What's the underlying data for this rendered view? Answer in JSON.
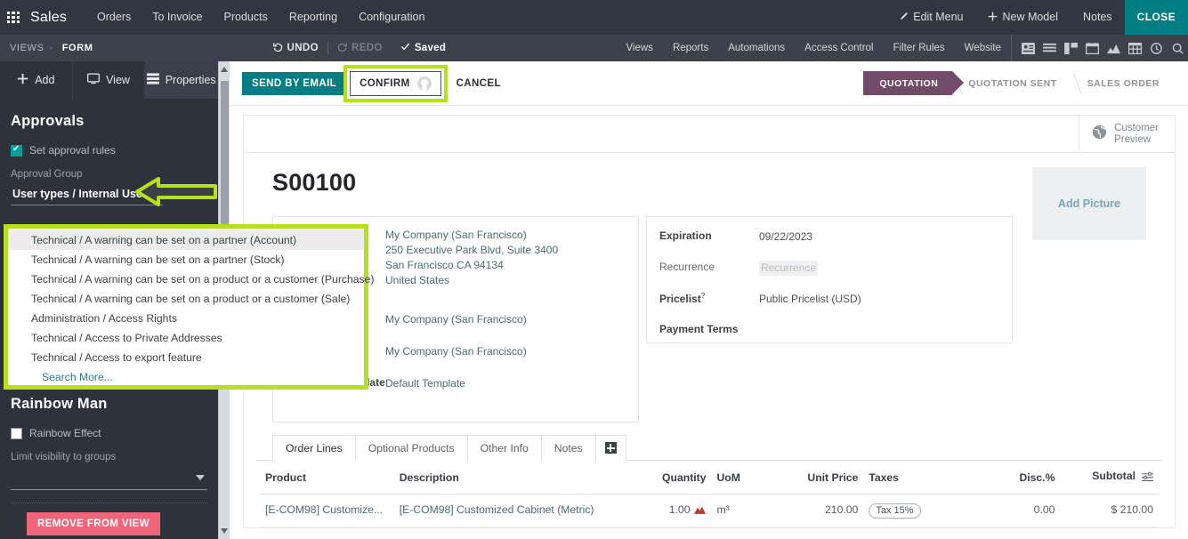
{
  "navbar": {
    "apps_icon": "apps-grid-icon",
    "brand": "Sales",
    "menu": [
      "Orders",
      "To Invoice",
      "Products",
      "Reporting",
      "Configuration"
    ],
    "right": [
      {
        "label": "Edit Menu",
        "icon": "pencil-icon"
      },
      {
        "label": "New Model",
        "icon": "plus-icon"
      },
      {
        "label": "Notes",
        "icon": ""
      }
    ],
    "close_label": "CLOSE"
  },
  "subbar": {
    "views_label": "VIEWS",
    "separator": "·",
    "form_label": "FORM",
    "undo_label": "UNDO",
    "redo_label": "REDO",
    "saved_label": "Saved",
    "links": [
      "Views",
      "Reports",
      "Automations",
      "Access Control",
      "Filter Rules",
      "Website"
    ],
    "icons": [
      "kanban-icon",
      "list-icon",
      "gantt-icon",
      "calendar-icon",
      "graph-icon",
      "pivot-icon",
      "activity-icon",
      "search-icon"
    ]
  },
  "sidebar": {
    "tabs": [
      {
        "label": "Add",
        "icon": "plus-icon",
        "active": false
      },
      {
        "label": "View",
        "icon": "monitor-icon",
        "active": false
      },
      {
        "label": "Properties",
        "icon": "properties-icon",
        "active": true
      }
    ],
    "approvals": {
      "title": "Approvals",
      "checkbox_label": "Set approval rules",
      "checkbox_checked": true,
      "group_label": "Approval Group",
      "group_value": "User types / Internal User",
      "filter_icon": "funnel-icon",
      "delete_icon": "trash-icon"
    },
    "rainbow": {
      "title": "Rainbow Man",
      "checkbox_label": "Rainbow Effect",
      "checkbox_checked": false,
      "limit_label": "Limit visibility to groups",
      "limit_value": "",
      "remove_label": "REMOVE FROM VIEW"
    }
  },
  "dropdown": {
    "items": [
      {
        "label": "Technical / A warning can be set on a partner (Account)",
        "highlighted": true
      },
      {
        "label": "Technical / A warning can be set on a partner (Stock)",
        "highlighted": false
      },
      {
        "label": "Technical / A warning can be set on a product or a customer (Purchase)",
        "highlighted": false
      },
      {
        "label": "Technical / A warning can be set on a product or a customer (Sale)",
        "highlighted": false
      },
      {
        "label": "Administration / Access Rights",
        "highlighted": false
      },
      {
        "label": "Technical / Access to Private Addresses",
        "highlighted": false
      },
      {
        "label": "Technical / Access to export feature",
        "highlighted": false
      }
    ],
    "search_more": "Search More...",
    "highlight_color": "#b4e01c"
  },
  "statusbar": {
    "send_by_email": "SEND BY EMAIL",
    "confirm": "CONFIRM",
    "confirm_badge_icon": "avatar-badge-icon",
    "cancel": "CANCEL",
    "pipeline": [
      {
        "label": "QUOTATION",
        "active": true
      },
      {
        "label": "QUOTATION SENT",
        "active": false
      },
      {
        "label": "SALES ORDER",
        "active": false
      }
    ],
    "active_color": "#714b67"
  },
  "sheet": {
    "customer_preview": {
      "line1": "Customer",
      "line2": "Preview",
      "icon": "globe-icon"
    },
    "doc_title": "S00100",
    "add_picture": "Add Picture",
    "left": {
      "customer_name": "My Company (San Francisco)",
      "address_line1": "250 Executive Park Blvd, Suite 3400",
      "address_line2": "San Francisco CA 94134",
      "address_line3": "United States",
      "invoice_address": "My Company (San Francisco)",
      "delivery_address": "My Company (San Francisco)",
      "quotation_template_label": "Quotation Template",
      "quotation_template_value": "Default Template"
    },
    "right": [
      {
        "label": "Expiration",
        "value": "09/22/2023",
        "bold": true,
        "muted": false
      },
      {
        "label": "Recurrence",
        "value": "Recurrence",
        "bold": false,
        "muted": true
      },
      {
        "label": "Pricelist",
        "value": "Public Pricelist (USD)",
        "bold": true,
        "muted": false,
        "help": "?"
      },
      {
        "label": "Payment Terms",
        "value": "",
        "bold": true,
        "muted": false
      }
    ]
  },
  "tabs": [
    {
      "label": "Order Lines",
      "active": true
    },
    {
      "label": "Optional Products",
      "active": false
    },
    {
      "label": "Other Info",
      "active": false
    },
    {
      "label": "Notes",
      "active": false
    }
  ],
  "table": {
    "columns": [
      "Product",
      "Description",
      "Quantity",
      "UoM",
      "Unit Price",
      "Taxes",
      "Disc.%",
      "Subtotal"
    ],
    "options_icon": "column-options-icon",
    "rows": [
      {
        "product": "[E-COM98] Customize...",
        "description": "[E-COM98] Customized Cabinet (Metric)",
        "quantity": "1.00",
        "quantity_icon": "forecast-icon",
        "uom": "m³",
        "unit_price": "210.00",
        "taxes": "Tax 15%",
        "discount": "0.00",
        "subtotal": "$ 210.00"
      }
    ]
  }
}
